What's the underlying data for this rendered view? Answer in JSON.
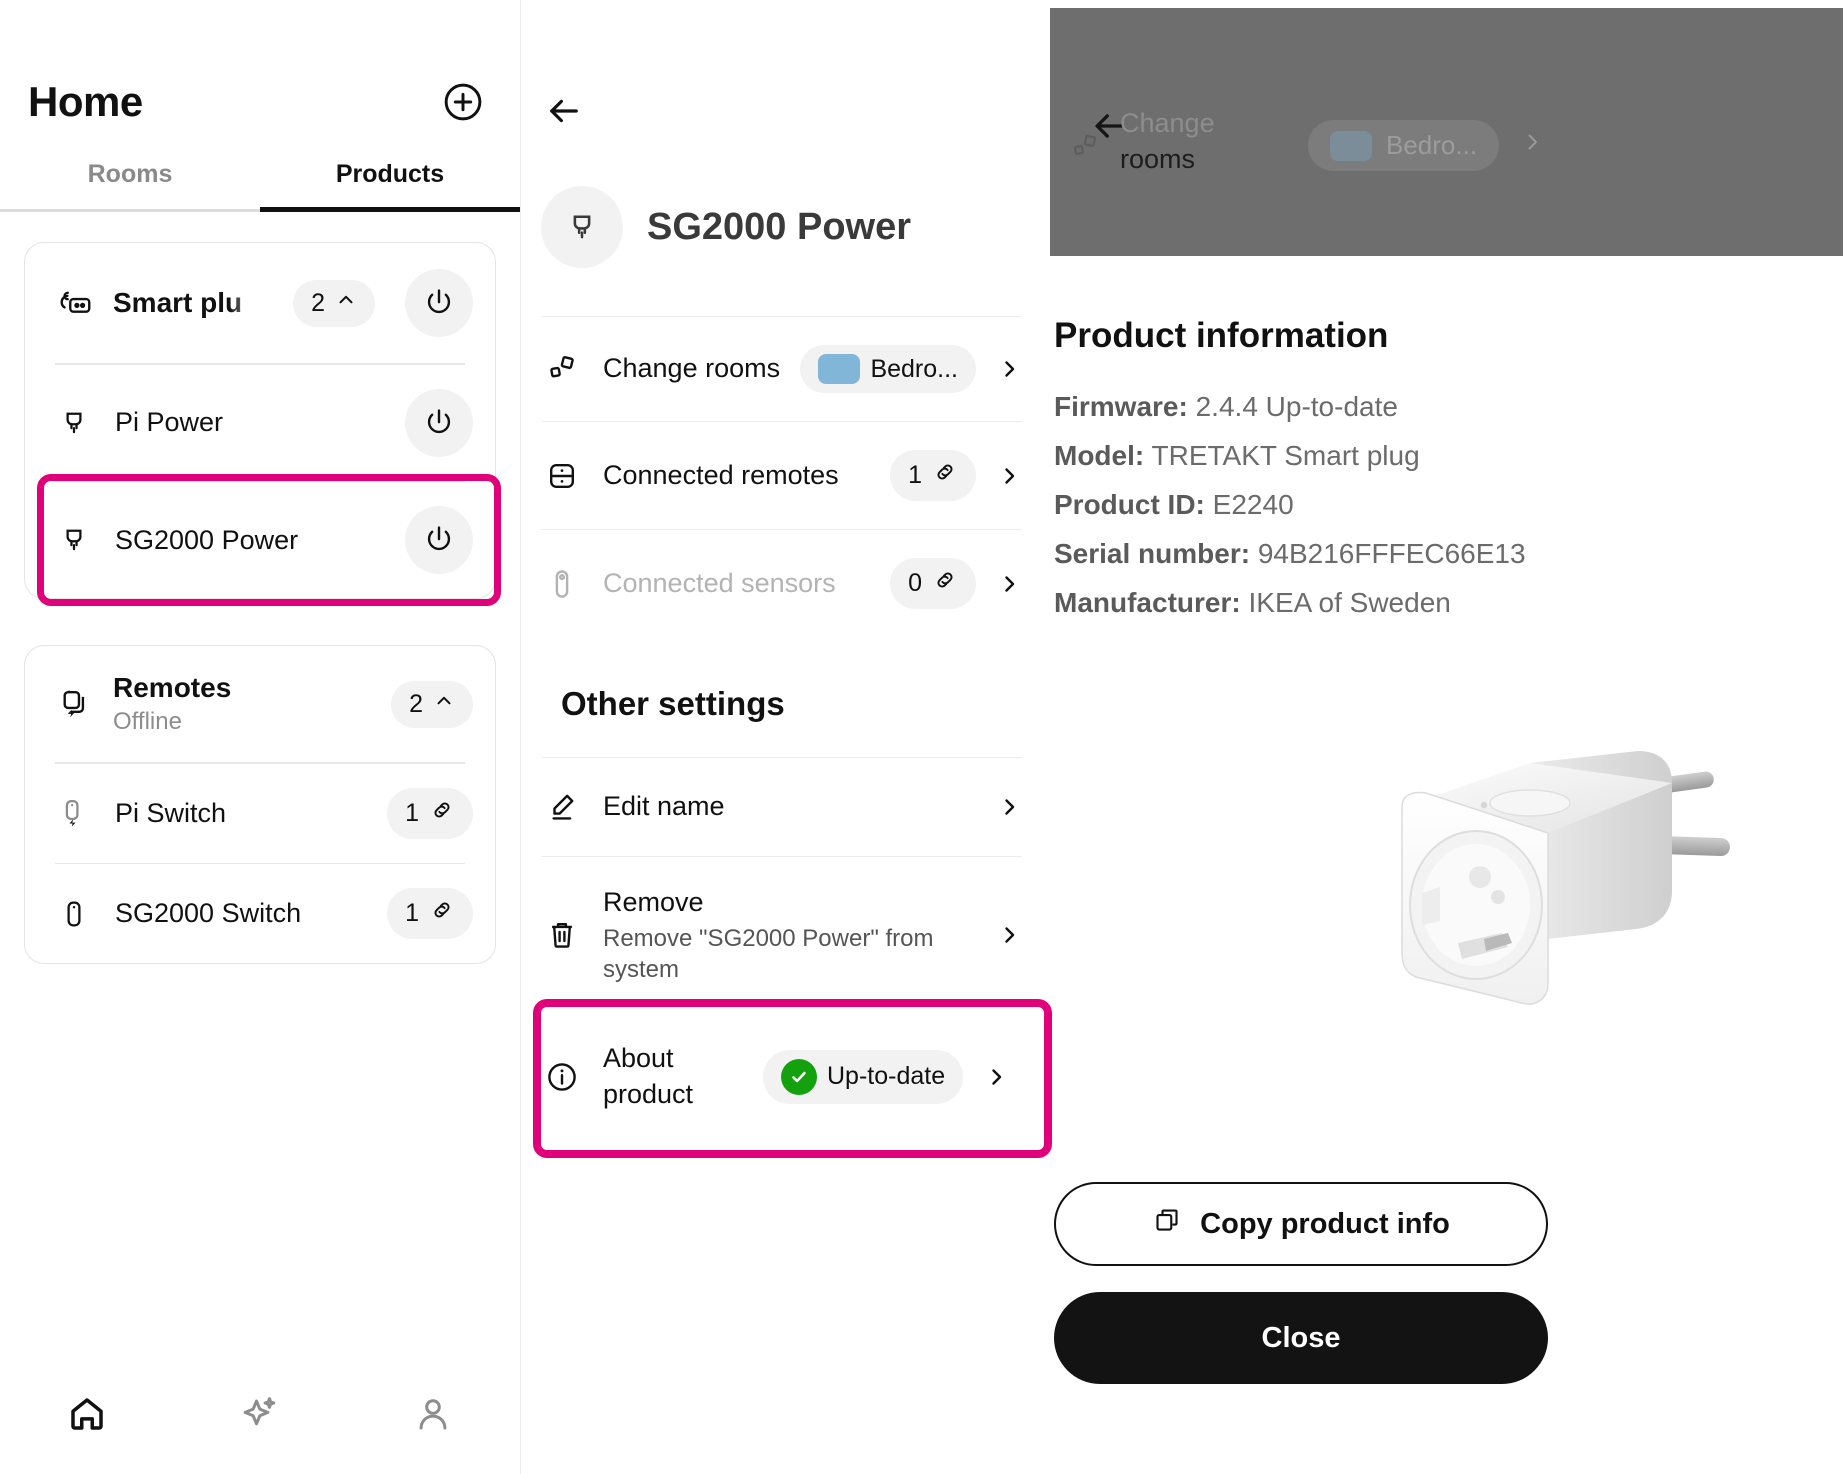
{
  "left": {
    "title": "Home",
    "add_icon": "plus-circle-icon",
    "tabs": [
      {
        "label": "Rooms",
        "active": false
      },
      {
        "label": "Products",
        "active": true
      }
    ],
    "groups": [
      {
        "name": "Smart plugs",
        "truncated_label": "Smart plu",
        "icon": "smart-plug-group-icon",
        "count": "2",
        "chevron": "chevron-up-icon",
        "devices": [
          {
            "name": "Pi Power",
            "icon": "plug-icon",
            "control": "power"
          },
          {
            "name": "SG2000 Power",
            "icon": "plug-icon",
            "control": "power",
            "selected": true
          }
        ]
      },
      {
        "name": "Remotes",
        "status": "Offline",
        "icon": "remote-group-icon",
        "count": "2",
        "chevron": "chevron-up-icon",
        "devices": [
          {
            "name": "Pi Switch",
            "icon": "switch-icon",
            "control": "link",
            "count": "1"
          },
          {
            "name": "SG2000 Switch",
            "icon": "switch-icon",
            "control": "link",
            "count": "1"
          }
        ]
      }
    ],
    "bottom_nav": [
      {
        "icon": "home-icon",
        "active": true
      },
      {
        "icon": "sparkle-icon",
        "active": false
      },
      {
        "icon": "person-icon",
        "active": false
      }
    ]
  },
  "middle": {
    "back_icon": "arrow-left-icon",
    "device_icon": "plug-icon",
    "title": "SG2000 Power",
    "rows": [
      {
        "label": "Change rooms",
        "icon": "rooms-icon",
        "pill_text": "Bedro...",
        "pill_swatch": "#82b6d9",
        "chevron": "chevron-right-icon",
        "disabled": false
      },
      {
        "label": "Connected remotes",
        "icon": "remote-device-icon",
        "pill_text": "1",
        "pill_icon": "link-icon",
        "chevron": "chevron-right-icon",
        "disabled": false
      },
      {
        "label": "Connected sensors",
        "icon": "sensor-icon",
        "pill_text": "0",
        "pill_icon": "link-icon",
        "chevron": "chevron-right-icon",
        "disabled": true
      }
    ],
    "other_settings_heading": "Other settings",
    "other_rows": [
      {
        "label": "Edit name",
        "icon": "pencil-icon",
        "chevron": "chevron-right-icon"
      },
      {
        "label": "Remove",
        "sub": "Remove \"SG2000 Power\" from system",
        "icon": "trash-icon",
        "chevron": "chevron-right-icon"
      },
      {
        "label": "About product",
        "icon": "info-icon",
        "pill_text": "Up-to-date",
        "pill_icon": "check-circle-icon",
        "chevron": "chevron-right-icon",
        "highlighted": true
      }
    ]
  },
  "right": {
    "dimmed_overlay": {
      "back_icon": "arrow-left-icon",
      "row_icon": "rooms-icon",
      "label_line1": "Change",
      "label_line2": "rooms",
      "pill_text": "Bedro...",
      "chevron": "chevron-right-icon"
    },
    "info": {
      "heading": "Product information",
      "rows": [
        {
          "label": "Firmware:",
          "value": "2.4.4 Up-to-date"
        },
        {
          "label": "Model:",
          "value": "TRETAKT Smart plug"
        },
        {
          "label": "Product ID:",
          "value": "E2240"
        },
        {
          "label": "Serial number:",
          "value": "94B216FFFEC66E13"
        },
        {
          "label": "Manufacturer:",
          "value": "IKEA of Sweden"
        }
      ]
    },
    "product_image_alt": "smart-plug-photo",
    "copy_button": {
      "label": "Copy product info",
      "icon": "copy-icon"
    },
    "close_button": {
      "label": "Close"
    }
  },
  "colors": {
    "highlight": "#e0007a",
    "status_green": "#13a10e",
    "room_swatch": "#82b6d9",
    "accent_dark": "#131313"
  }
}
